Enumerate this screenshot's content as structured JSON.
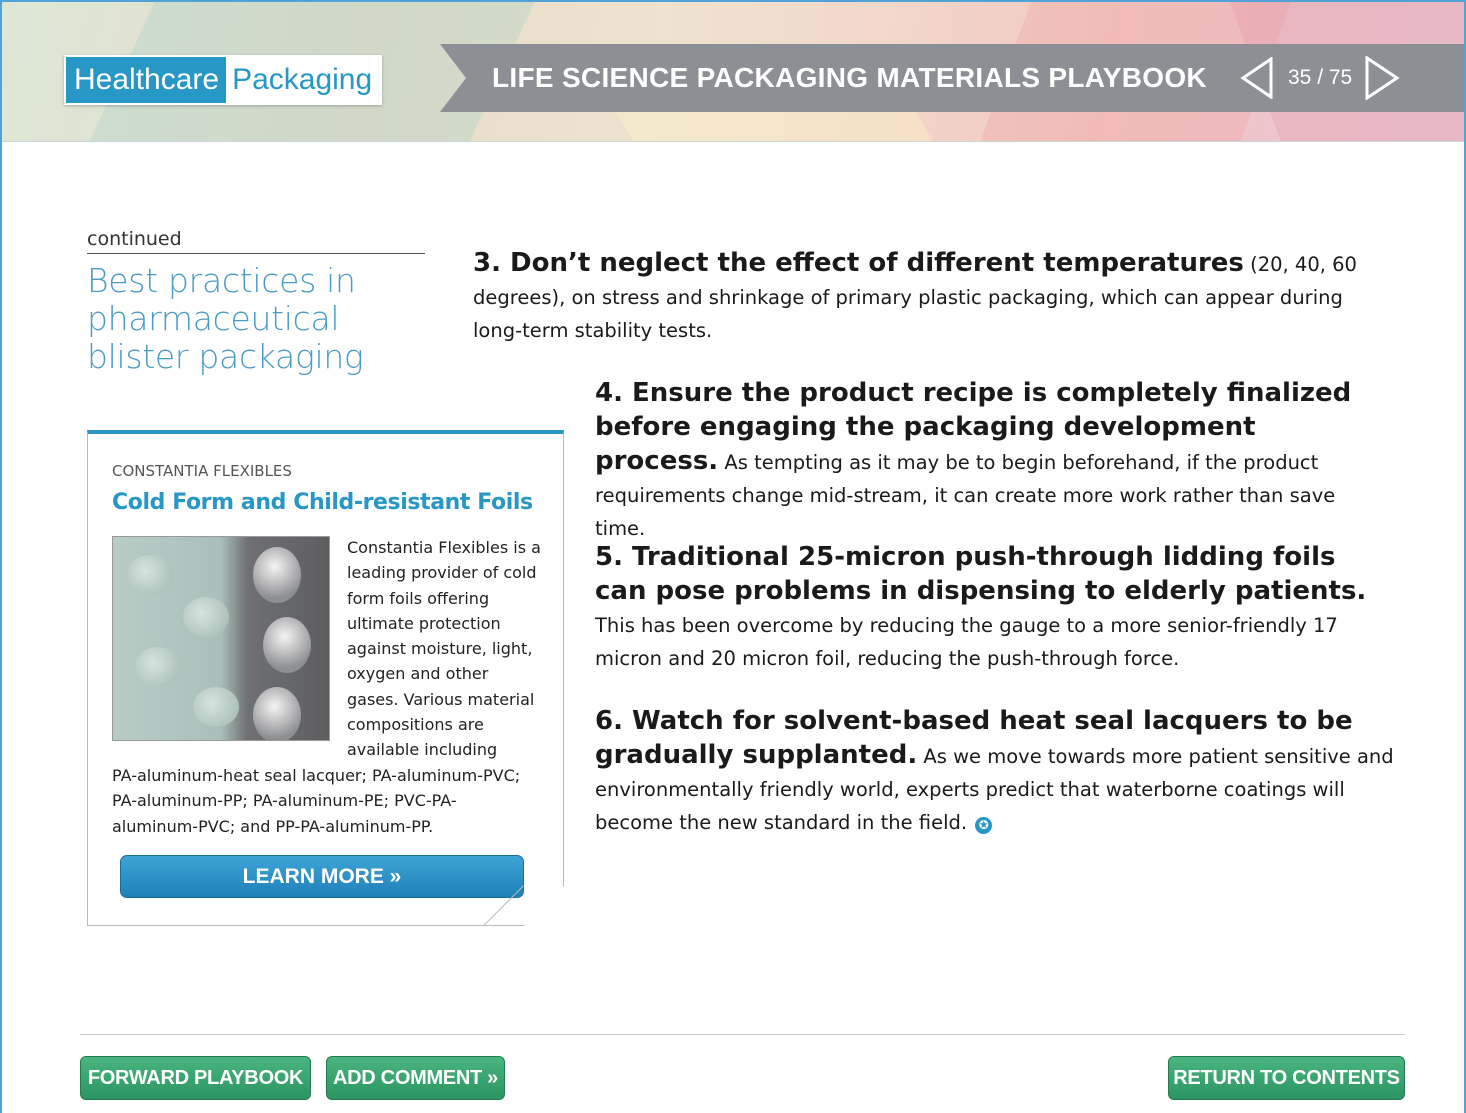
{
  "header": {
    "logo_part1": "Healthcare",
    "logo_part2": "Packaging",
    "title": "LIFE SCIENCE PACKAGING MATERIALS PLAYBOOK",
    "page_current": "35",
    "page_total": "75",
    "page_label": "35 / 75"
  },
  "section": {
    "continued_label": "continued",
    "title": "Best practices in pharmaceutical blister packaging"
  },
  "sidebar": {
    "company": "CONSTANTIA FLEXIBLES",
    "heading": "Cold Form and Child-resistant Foils",
    "text_beside_image": "Constantia Flexibles is a leading provider of cold form foils offering ultimate protection against moisture, light, oxygen and other gases. Various material compositions are available including",
    "text_below_image": "PA-aluminum-heat seal lacquer; PA-aluminum-PVC; PA-aluminum-PP; PA-aluminum-PE; PVC-PA-aluminum-PVC; and PP-PA-aluminum-PP.",
    "learn_more": "LEARN MORE »"
  },
  "items": [
    {
      "bold": "3. Don’t neglect the effect of different temperatures",
      "text": " (20, 40, 60 degrees), on stress and shrinkage of primary plastic packaging, which can appear during long-term stability tests."
    },
    {
      "bold": "4. Ensure the product recipe is completely finalized before engaging the packaging development process.",
      "text": " As tempting as it may be to begin beforehand, if the product requirements change mid-stream, it can create more work rather than save time."
    },
    {
      "bold": "5. Traditional 25-micron push-through lidding foils can pose problems in dispensing to elderly patients.",
      "text": " This has been overcome by reducing the gauge to a more senior-friendly 17 micron and 20 micron foil, reducing the push-through force."
    },
    {
      "bold": "6. Watch for solvent-based heat seal lacquers to be gradually supplanted.",
      "text": "  As we move towards more patient sensitive and environmentally friendly world, experts predict that waterborne coatings will become the new standard in the field."
    }
  ],
  "footer": {
    "forward": "FORWARD PLAYBOOK »",
    "comment": "ADD COMMENT »",
    "contents": "RETURN TO CONTENTS »"
  },
  "colors": {
    "brand_blue": "#2797c6",
    "title_bar_gray": "#8c8f93",
    "footer_button_green": "#3aa672",
    "frame_border": "#4fa3d8"
  },
  "icons": {
    "prev": "triangle-left-outline",
    "next": "triangle-right-outline",
    "end_mark": "star-in-circle"
  }
}
